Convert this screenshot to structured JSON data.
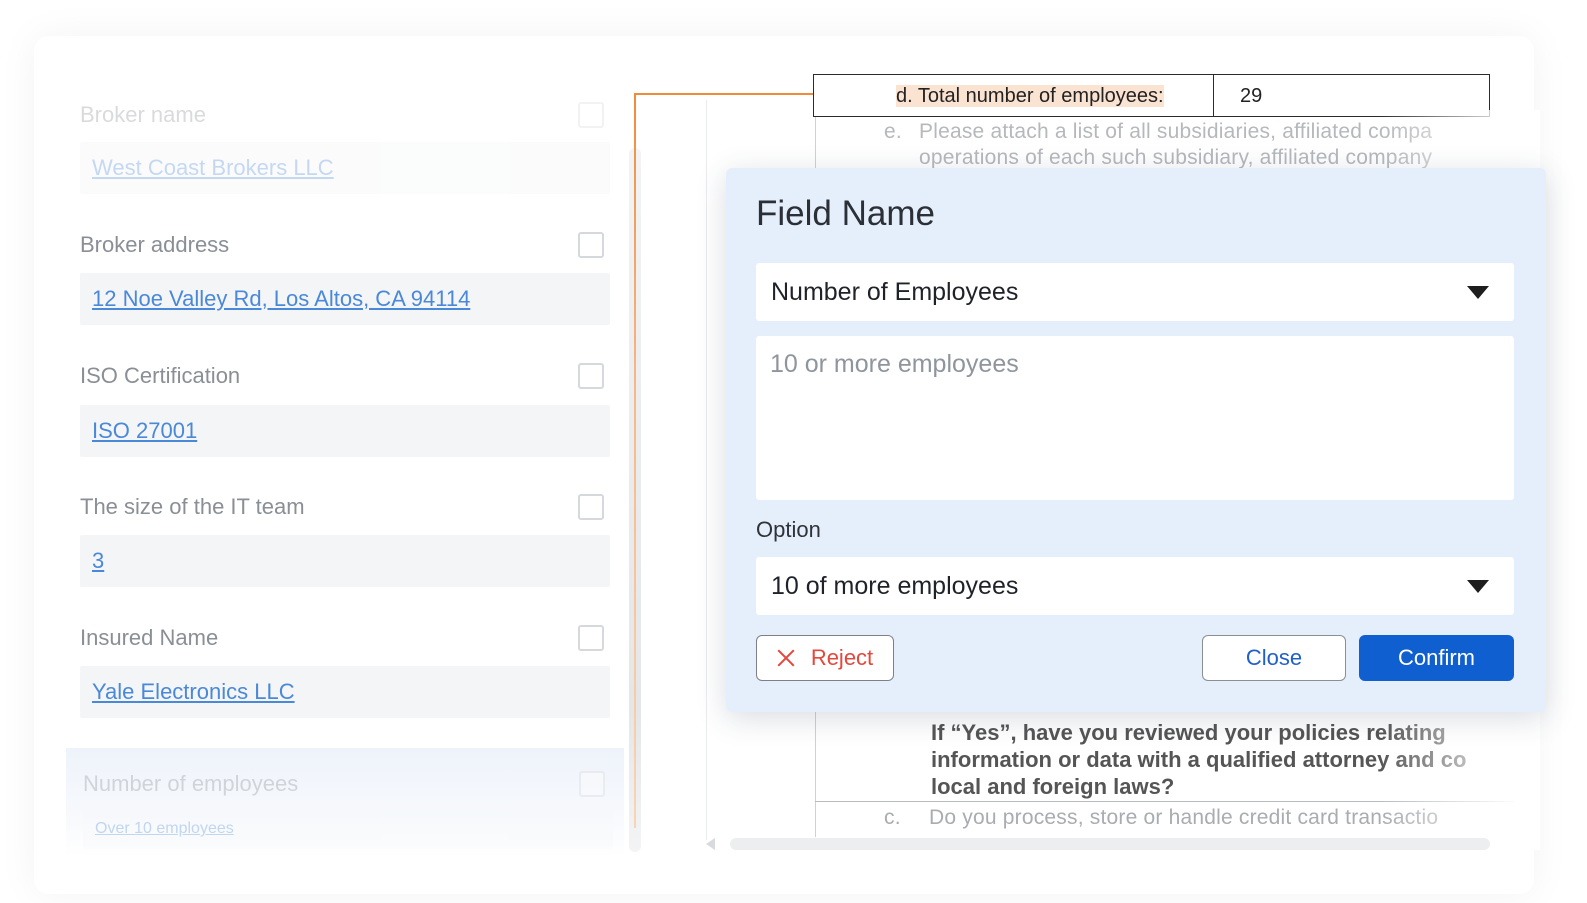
{
  "fields": [
    {
      "label": "Broker name",
      "value": "West Coast Brokers LLC"
    },
    {
      "label": "Broker address",
      "value": "12 Noe Valley Rd, Los Altos, CA 94114"
    },
    {
      "label": "ISO Certification",
      "value": "ISO 27001"
    },
    {
      "label": "The size of the IT team",
      "value": "3"
    },
    {
      "label": "Insured Name",
      "value": "Yale Electronics LLC"
    },
    {
      "label": "Number of employees",
      "value": "Over 10 employees"
    }
  ],
  "document": {
    "question": "d.  Total number of employees:",
    "answer": "29",
    "line_e_letter": "e.",
    "line_e1": "Please attach a list of all subsidiaries, affiliated compa",
    "line_e2": "operations of each such subsidiary, affiliated company",
    "bold_line1": "If “Yes”, have you reviewed your policies relating",
    "bold_line2": "information or data with a qualified attorney and co",
    "bold_line3": "local and foreign laws?",
    "line_c_letter": "c.",
    "line_c": "Do you process, store or handle credit card transactio"
  },
  "modal": {
    "title": "Field Name",
    "field_select": "Number of Employees",
    "textarea_placeholder": "10 or more employees",
    "option_label": "Option",
    "option_select": "10 of more employees",
    "reject_label": "Reject",
    "close_label": "Close",
    "confirm_label": "Confirm"
  },
  "colors": {
    "accent": "#0f5fd0",
    "connector": "#f08b3c",
    "reject": "#e4473b",
    "link": "#4a88d8"
  }
}
